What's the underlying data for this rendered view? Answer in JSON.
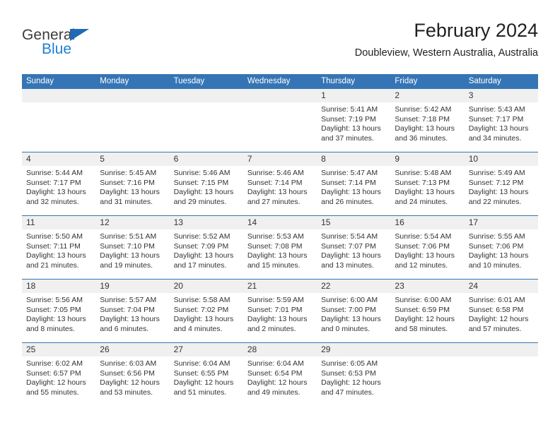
{
  "brand": {
    "name_top": "General",
    "name_bottom": "Blue",
    "triangle_icon": "brand-triangle-icon",
    "accent_blue": "#1f7fd0",
    "logo_text_color": "#3b3b3b"
  },
  "header": {
    "month_title": "February 2024",
    "location": "Doubleview, Western Australia, Australia"
  },
  "theme": {
    "header_blue": "#3575b5",
    "daynum_strip": "#f0f0f0",
    "text": "#333333"
  },
  "weekdays": [
    "Sunday",
    "Monday",
    "Tuesday",
    "Wednesday",
    "Thursday",
    "Friday",
    "Saturday"
  ],
  "weeks": [
    [
      {
        "day": "",
        "lines": []
      },
      {
        "day": "",
        "lines": []
      },
      {
        "day": "",
        "lines": []
      },
      {
        "day": "",
        "lines": []
      },
      {
        "day": "1",
        "lines": [
          "Sunrise: 5:41 AM",
          "Sunset: 7:19 PM",
          "Daylight: 13 hours",
          "and 37 minutes."
        ]
      },
      {
        "day": "2",
        "lines": [
          "Sunrise: 5:42 AM",
          "Sunset: 7:18 PM",
          "Daylight: 13 hours",
          "and 36 minutes."
        ]
      },
      {
        "day": "3",
        "lines": [
          "Sunrise: 5:43 AM",
          "Sunset: 7:17 PM",
          "Daylight: 13 hours",
          "and 34 minutes."
        ]
      }
    ],
    [
      {
        "day": "4",
        "lines": [
          "Sunrise: 5:44 AM",
          "Sunset: 7:17 PM",
          "Daylight: 13 hours",
          "and 32 minutes."
        ]
      },
      {
        "day": "5",
        "lines": [
          "Sunrise: 5:45 AM",
          "Sunset: 7:16 PM",
          "Daylight: 13 hours",
          "and 31 minutes."
        ]
      },
      {
        "day": "6",
        "lines": [
          "Sunrise: 5:46 AM",
          "Sunset: 7:15 PM",
          "Daylight: 13 hours",
          "and 29 minutes."
        ]
      },
      {
        "day": "7",
        "lines": [
          "Sunrise: 5:46 AM",
          "Sunset: 7:14 PM",
          "Daylight: 13 hours",
          "and 27 minutes."
        ]
      },
      {
        "day": "8",
        "lines": [
          "Sunrise: 5:47 AM",
          "Sunset: 7:14 PM",
          "Daylight: 13 hours",
          "and 26 minutes."
        ]
      },
      {
        "day": "9",
        "lines": [
          "Sunrise: 5:48 AM",
          "Sunset: 7:13 PM",
          "Daylight: 13 hours",
          "and 24 minutes."
        ]
      },
      {
        "day": "10",
        "lines": [
          "Sunrise: 5:49 AM",
          "Sunset: 7:12 PM",
          "Daylight: 13 hours",
          "and 22 minutes."
        ]
      }
    ],
    [
      {
        "day": "11",
        "lines": [
          "Sunrise: 5:50 AM",
          "Sunset: 7:11 PM",
          "Daylight: 13 hours",
          "and 21 minutes."
        ]
      },
      {
        "day": "12",
        "lines": [
          "Sunrise: 5:51 AM",
          "Sunset: 7:10 PM",
          "Daylight: 13 hours",
          "and 19 minutes."
        ]
      },
      {
        "day": "13",
        "lines": [
          "Sunrise: 5:52 AM",
          "Sunset: 7:09 PM",
          "Daylight: 13 hours",
          "and 17 minutes."
        ]
      },
      {
        "day": "14",
        "lines": [
          "Sunrise: 5:53 AM",
          "Sunset: 7:08 PM",
          "Daylight: 13 hours",
          "and 15 minutes."
        ]
      },
      {
        "day": "15",
        "lines": [
          "Sunrise: 5:54 AM",
          "Sunset: 7:07 PM",
          "Daylight: 13 hours",
          "and 13 minutes."
        ]
      },
      {
        "day": "16",
        "lines": [
          "Sunrise: 5:54 AM",
          "Sunset: 7:06 PM",
          "Daylight: 13 hours",
          "and 12 minutes."
        ]
      },
      {
        "day": "17",
        "lines": [
          "Sunrise: 5:55 AM",
          "Sunset: 7:06 PM",
          "Daylight: 13 hours",
          "and 10 minutes."
        ]
      }
    ],
    [
      {
        "day": "18",
        "lines": [
          "Sunrise: 5:56 AM",
          "Sunset: 7:05 PM",
          "Daylight: 13 hours",
          "and 8 minutes."
        ]
      },
      {
        "day": "19",
        "lines": [
          "Sunrise: 5:57 AM",
          "Sunset: 7:04 PM",
          "Daylight: 13 hours",
          "and 6 minutes."
        ]
      },
      {
        "day": "20",
        "lines": [
          "Sunrise: 5:58 AM",
          "Sunset: 7:02 PM",
          "Daylight: 13 hours",
          "and 4 minutes."
        ]
      },
      {
        "day": "21",
        "lines": [
          "Sunrise: 5:59 AM",
          "Sunset: 7:01 PM",
          "Daylight: 13 hours",
          "and 2 minutes."
        ]
      },
      {
        "day": "22",
        "lines": [
          "Sunrise: 6:00 AM",
          "Sunset: 7:00 PM",
          "Daylight: 13 hours",
          "and 0 minutes."
        ]
      },
      {
        "day": "23",
        "lines": [
          "Sunrise: 6:00 AM",
          "Sunset: 6:59 PM",
          "Daylight: 12 hours",
          "and 58 minutes."
        ]
      },
      {
        "day": "24",
        "lines": [
          "Sunrise: 6:01 AM",
          "Sunset: 6:58 PM",
          "Daylight: 12 hours",
          "and 57 minutes."
        ]
      }
    ],
    [
      {
        "day": "25",
        "lines": [
          "Sunrise: 6:02 AM",
          "Sunset: 6:57 PM",
          "Daylight: 12 hours",
          "and 55 minutes."
        ]
      },
      {
        "day": "26",
        "lines": [
          "Sunrise: 6:03 AM",
          "Sunset: 6:56 PM",
          "Daylight: 12 hours",
          "and 53 minutes."
        ]
      },
      {
        "day": "27",
        "lines": [
          "Sunrise: 6:04 AM",
          "Sunset: 6:55 PM",
          "Daylight: 12 hours",
          "and 51 minutes."
        ]
      },
      {
        "day": "28",
        "lines": [
          "Sunrise: 6:04 AM",
          "Sunset: 6:54 PM",
          "Daylight: 12 hours",
          "and 49 minutes."
        ]
      },
      {
        "day": "29",
        "lines": [
          "Sunrise: 6:05 AM",
          "Sunset: 6:53 PM",
          "Daylight: 12 hours",
          "and 47 minutes."
        ]
      },
      {
        "day": "",
        "lines": []
      },
      {
        "day": "",
        "lines": []
      }
    ]
  ]
}
